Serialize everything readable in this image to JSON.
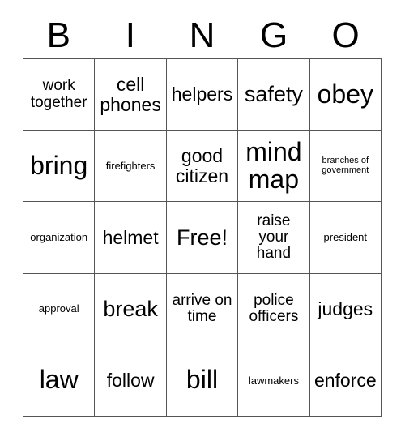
{
  "card": {
    "title_letters": [
      "B",
      "I",
      "N",
      "G",
      "O"
    ],
    "grid_size": "5x5",
    "free_space": "Free!",
    "colors": {
      "background": "#ffffff",
      "text": "#000000",
      "border": "#555555"
    },
    "rows": [
      [
        {
          "text": "work together",
          "size": "sm"
        },
        {
          "text": "cell phones",
          "size": "md"
        },
        {
          "text": "helpers",
          "size": "md"
        },
        {
          "text": "safety",
          "size": "lg"
        },
        {
          "text": "obey",
          "size": "xl"
        }
      ],
      [
        {
          "text": "bring",
          "size": "xl"
        },
        {
          "text": "firefighters",
          "size": "xs"
        },
        {
          "text": "good citizen",
          "size": "md"
        },
        {
          "text": "mind map",
          "size": "xl"
        },
        {
          "text": "branches of government",
          "size": "xxs"
        }
      ],
      [
        {
          "text": "organization",
          "size": "xs"
        },
        {
          "text": "helmet",
          "size": "md"
        },
        {
          "text": "Free!",
          "size": "lg"
        },
        {
          "text": "raise your hand",
          "size": "sm"
        },
        {
          "text": "president",
          "size": "xs"
        }
      ],
      [
        {
          "text": "approval",
          "size": "xs"
        },
        {
          "text": "break",
          "size": "lg"
        },
        {
          "text": "arrive on time",
          "size": "sm"
        },
        {
          "text": "police officers",
          "size": "sm"
        },
        {
          "text": "judges",
          "size": "md"
        }
      ],
      [
        {
          "text": "law",
          "size": "xl"
        },
        {
          "text": "follow",
          "size": "md"
        },
        {
          "text": "bill",
          "size": "xl"
        },
        {
          "text": "lawmakers",
          "size": "xs"
        },
        {
          "text": "enforce",
          "size": "md"
        }
      ]
    ]
  }
}
